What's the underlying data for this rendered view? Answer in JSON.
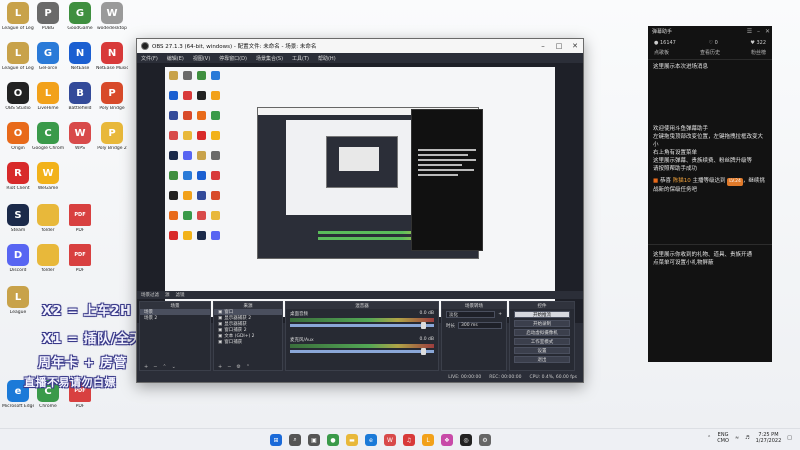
{
  "desktop": {
    "icons": [
      {
        "label": "League of Legends",
        "color": "#c8a24a",
        "glyph": "L",
        "name": "league-of-legends-icon"
      },
      {
        "label": "PUBG",
        "color": "#6a6a6a",
        "glyph": "P",
        "name": "pubg-icon"
      },
      {
        "label": "GoodGame",
        "color": "#3f8f3f",
        "glyph": "G",
        "name": "goodgame-icon"
      },
      {
        "label": "wodedesktop",
        "color": "#9a9a9a",
        "glyph": "W",
        "name": "wode-icon"
      },
      {
        "label": "League of Legends",
        "color": "#c8a24a",
        "glyph": "L",
        "name": "league-of-legends-2-icon"
      },
      {
        "label": "GeForce",
        "color": "#2a7ad8",
        "glyph": "G",
        "name": "geforce-icon"
      },
      {
        "label": "NetEase",
        "color": "#1b5fd1",
        "glyph": "N",
        "name": "netease-icon"
      },
      {
        "label": "NetEase Music",
        "color": "#d83a3a",
        "glyph": "N",
        "name": "netease-music-icon"
      },
      {
        "label": "OBS Studio",
        "color": "#222222",
        "glyph": "O",
        "name": "obs-studio-icon"
      },
      {
        "label": "LiveHime",
        "color": "#f2a11a",
        "glyph": "L",
        "name": "livehime-icon"
      },
      {
        "label": "Battlefield",
        "color": "#334a99",
        "glyph": "B",
        "name": "battlefield-icon"
      },
      {
        "label": "Poly Bridge",
        "color": "#d84a2a",
        "glyph": "P",
        "name": "poly-bridge-icon"
      },
      {
        "label": "Origin",
        "color": "#e86a1a",
        "glyph": "O",
        "name": "origin-icon"
      },
      {
        "label": "Google Chrome",
        "color": "#3a9a4a",
        "glyph": "C",
        "name": "chrome-icon"
      },
      {
        "label": "WPS",
        "color": "#d84a4a",
        "glyph": "W",
        "name": "wps-icon"
      },
      {
        "label": "Poly Bridge 2",
        "color": "#e8b83a",
        "glyph": "P",
        "name": "folder-icon"
      },
      {
        "label": "Riot Client",
        "color": "#d82a2a",
        "glyph": "R",
        "name": "riot-client-icon"
      },
      {
        "label": "WeGame",
        "color": "#f2b21a",
        "glyph": "W",
        "name": "wegame-icon"
      },
      {
        "label": "Steam",
        "color": "#1b2a4a",
        "glyph": "S",
        "name": "steam-icon"
      },
      {
        "label": "folder",
        "color": "#e8b83a",
        "glyph": "",
        "name": "folder-2-icon"
      },
      {
        "label": "PDF",
        "color": "#d84040",
        "glyph": "PDF",
        "name": "pdf-icon"
      },
      {
        "label": "Discord",
        "color": "#5865f2",
        "glyph": "D",
        "name": "discord-icon"
      },
      {
        "label": "folder",
        "color": "#e8b83a",
        "glyph": "",
        "name": "folder-3-icon"
      },
      {
        "label": "PDF",
        "color": "#d84040",
        "glyph": "PDF",
        "name": "pdf-2-icon"
      },
      {
        "label": "League",
        "color": "#c8a24a",
        "glyph": "L",
        "name": "league-3-icon"
      },
      {
        "label": "Microsoft Edge",
        "color": "#1b7ad8",
        "glyph": "e",
        "name": "edge-icon"
      },
      {
        "label": "Chrome",
        "color": "#3a9a4a",
        "glyph": "C",
        "name": "chrome-2-icon"
      },
      {
        "label": "PDF",
        "color": "#d84040",
        "glyph": "PDF",
        "name": "pdf-3-icon"
      }
    ]
  },
  "overlay": {
    "line1": "X2 = 上车2H",
    "line2": "X1 = 插队/全天",
    "line3": "周年卡 + 房管",
    "line4": "直播不易请勿白嫖"
  },
  "obs": {
    "title": "OBS 27.1.3 (64-bit, windows) - 配置文件: 未命名 - 场景: 未命名",
    "menu": [
      "文件(F)",
      "编辑(E)",
      "视图(V)",
      "停靠窗口(D)",
      "场景集合(S)",
      "工具(T)",
      "帮助(H)"
    ],
    "docks_header": [
      "场景过滤",
      "源",
      "滤镜"
    ],
    "scenes": {
      "title": "场景",
      "items": [
        "场景",
        "场景 2"
      ]
    },
    "sources": {
      "title": "来源",
      "items": [
        "窗口",
        "显示器捕获 2",
        "显示器捕获",
        "窗口捕获 2",
        "文本 (GDI+) 2",
        "窗口捕获"
      ]
    },
    "mixer": {
      "title": "混音器",
      "tracks": [
        {
          "name": "桌面音频",
          "db": "0.0 dB"
        },
        {
          "name": "麦克风/Aux",
          "db": "0.0 dB"
        }
      ]
    },
    "transitions": {
      "title": "场景转场",
      "type": "淡化",
      "duration_label": "时长",
      "duration": "300 ms"
    },
    "controls": {
      "title": "控件",
      "buttons": [
        "开始推流",
        "开始录制",
        "启动虚拟摄像机",
        "工作室模式",
        "设置",
        "退出"
      ]
    },
    "status": {
      "live": "LIVE: 00:00:00",
      "rec": "REC: 00:00:00",
      "cpu": "CPU: 0.4%, 60.00 fps"
    }
  },
  "panel": {
    "title": "弹幕助手",
    "stats": {
      "viewers": "16147",
      "fans": "0",
      "gifts": "322"
    },
    "tabs": [
      "点歌板",
      "查看历史",
      "粉丝榜"
    ],
    "msg_top": "这里展示本次进场消息",
    "welcome_lines": [
      "欢迎使用斗鱼弹幕助手",
      "左键拖曳顶部改变位置，左键拖拽拉框改变大小",
      "右上角有设置菜单",
      "这里展示弹幕、贵族续费、粉丝牌升级等",
      "请按照帮助手成功"
    ],
    "gift_line": "恭喜 陈猫10 主播等级达到 LV.24，继续挑战新的保级任务吧",
    "gift_name": "陈猫10",
    "gift_badge": "LV.24",
    "msg_bottom1": "这里展示你收到的礼物、道具、贵族开通",
    "msg_bottom2": "点菜单可设置小礼物屏蔽"
  },
  "taskbar": {
    "time": "7:25 PM",
    "date": "1/27/2022",
    "lang": "ENG",
    "region": "CMO"
  }
}
